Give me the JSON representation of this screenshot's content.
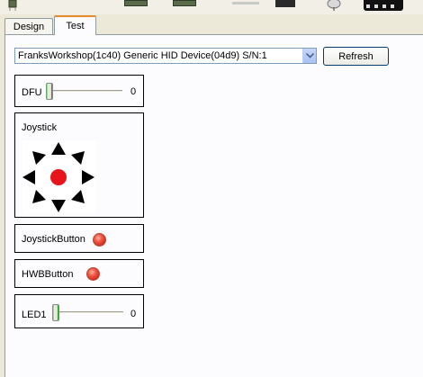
{
  "toolbar": {
    "parts": [
      "chip-icon",
      "board-icon",
      "board-icon",
      "connector-icon",
      "black-component-icon",
      "round-component-icon",
      "display-icon"
    ]
  },
  "tabs": [
    {
      "label": "Design",
      "active": false
    },
    {
      "label": "Test",
      "active": true
    }
  ],
  "device": {
    "selected": "FranksWorkshop(1c40) Generic HID Device(04d9)  S/N:1",
    "refresh_label": "Refresh"
  },
  "controls": {
    "dfu": {
      "label": "DFU",
      "value": "0",
      "level": 0
    },
    "joystick": {
      "label": "Joystick",
      "center_color": "#e8141c",
      "arrow_color": "#000000"
    },
    "joystick_button": {
      "label": "JoystickButton",
      "led_color": "#e8453a"
    },
    "hwb_button": {
      "label": "HWBButton",
      "led_color": "#e8453a"
    },
    "led1": {
      "label": "LED1",
      "value": "0",
      "level": 0
    }
  },
  "colors": {
    "window_bg": "#ece9d8",
    "panel_bg": "#fcfcfe",
    "active_tab_accent": "#e68b2c",
    "button_border": "#003c74"
  }
}
